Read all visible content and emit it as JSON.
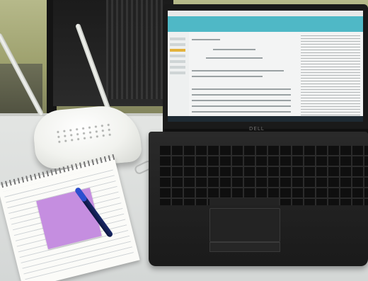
{
  "scene": {
    "description_labels": {
      "laptop_brand": "DELL"
    }
  }
}
